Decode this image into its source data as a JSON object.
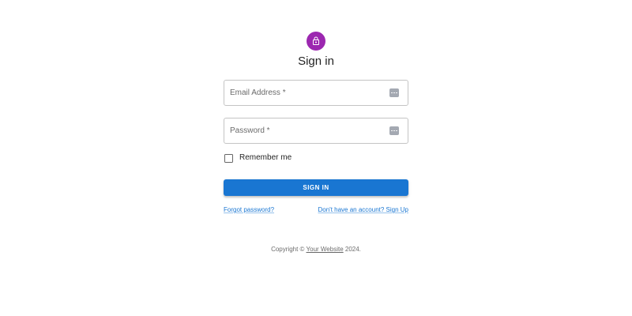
{
  "header": {
    "icon": "lock-outlined-icon",
    "avatar_color": "#9c27b0",
    "title": "Sign in"
  },
  "form": {
    "email": {
      "label": "Email Address *",
      "value": "",
      "autofill_icon": "password-manager-dots-icon"
    },
    "password": {
      "label": "Password *",
      "value": "",
      "autofill_icon": "password-manager-dots-icon"
    },
    "remember_me": {
      "label": "Remember me",
      "checked": false
    },
    "submit_label": "SIGN IN",
    "primary_color": "#1976d2"
  },
  "links": {
    "forgot_password": "Forgot password?",
    "sign_up": "Don't have an account? Sign Up"
  },
  "footer": {
    "prefix": "Copyright © ",
    "site_name": "Your Website",
    "suffix": " 2024."
  }
}
